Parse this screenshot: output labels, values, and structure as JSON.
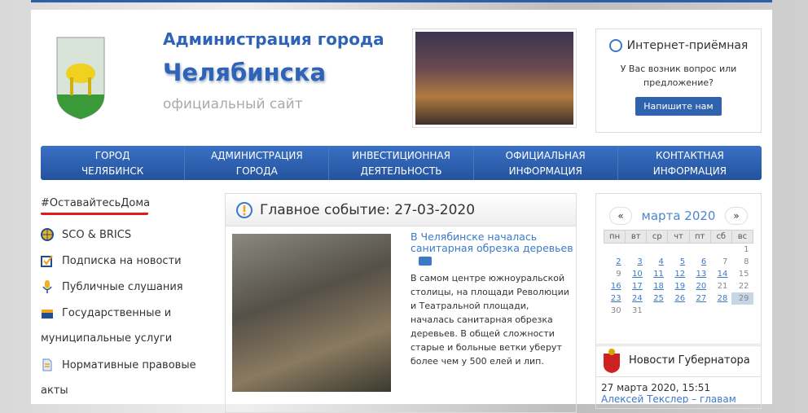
{
  "header": {
    "title_line1": "Администрация города",
    "title_line2": "Челябинска",
    "subtitle": "официальный сайт"
  },
  "reception": {
    "title": "Интернет-приёмная",
    "text": "У Вас возник вопрос или предложение?",
    "button": "Напишите нам"
  },
  "nav": [
    {
      "line1": "ГОРОД",
      "line2": "ЧЕЛЯБИНСК"
    },
    {
      "line1": "АДМИНИСТРАЦИЯ",
      "line2": "ГОРОДА"
    },
    {
      "line1": "ИНВЕСТИЦИОННАЯ",
      "line2": "ДЕЯТЕЛЬНОСТЬ"
    },
    {
      "line1": "ОФИЦИАЛЬНАЯ",
      "line2": "ИНФОРМАЦИЯ"
    },
    {
      "line1": "КОНТАКТНАЯ",
      "line2": "ИНФОРМАЦИЯ"
    }
  ],
  "sidebar": {
    "hashtag": "#ОставайтесьДома",
    "items": [
      {
        "label": "SCO & BRICS",
        "icon": "globe-icon"
      },
      {
        "label": "Подписка на новости",
        "icon": "checkbox-icon"
      },
      {
        "label": "Публичные слушания",
        "icon": "microphone-icon"
      },
      {
        "label": "Государственные и",
        "cont": "муниципальные услуги",
        "icon": "briefcase-icon"
      },
      {
        "label": "Нормативные правовые",
        "cont": "акты",
        "icon": "document-icon"
      }
    ]
  },
  "main": {
    "heading": "Главное событие: 27-03-2020",
    "news_title": "В Челябинске началась санитарная обрезка деревьев",
    "news_text": "В самом центре южноуральской столицы, на площади Революции и Театральной площади, началась санитарная обрезка деревьев. В общей сложности старые и больные ветки уберут более чем у 500 елей и лип."
  },
  "calendar": {
    "prev": "«",
    "next": "»",
    "title": "марта 2020",
    "weekdays": [
      "пн",
      "вт",
      "ср",
      "чт",
      "пт",
      "сб",
      "вс"
    ],
    "weeks": [
      [
        "",
        "",
        "",
        "",
        "",
        "",
        "1"
      ],
      [
        "2",
        "3",
        "4",
        "5",
        "6",
        "7",
        "8"
      ],
      [
        "9",
        "10",
        "11",
        "12",
        "13",
        "14",
        "15"
      ],
      [
        "16",
        "17",
        "18",
        "19",
        "20",
        "21",
        "22"
      ],
      [
        "23",
        "24",
        "25",
        "26",
        "27",
        "28",
        "29"
      ],
      [
        "30",
        "31",
        "",
        "",
        "",
        "",
        ""
      ]
    ],
    "linked": [
      "2",
      "3",
      "4",
      "5",
      "6",
      "10",
      "11",
      "12",
      "13",
      "14",
      "16",
      "17",
      "18",
      "19",
      "20",
      "23",
      "24",
      "25",
      "26",
      "27",
      "28"
    ],
    "selected": "29"
  },
  "governor": {
    "title": "Новости Губернатора",
    "date": "27 марта 2020, 15:51",
    "link": "Алексей Текслер – главам"
  },
  "colors": {
    "brand": "#2f5ea8",
    "hashtag_underline": "#e21b1b"
  }
}
